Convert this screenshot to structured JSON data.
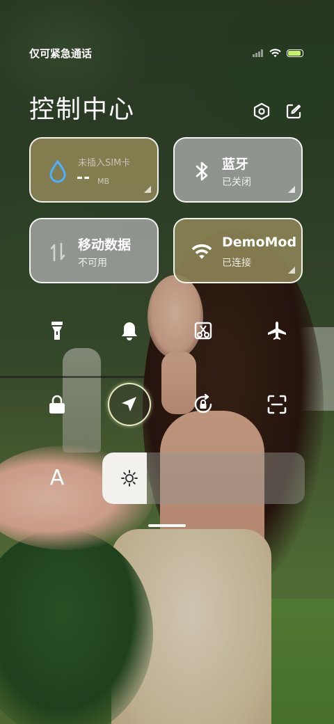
{
  "status_bar": {
    "carrier_text": "仅可紧急通话",
    "battery_level": 0.9
  },
  "header": {
    "title": "控制中心",
    "settings_icon": "hexagon-settings-icon",
    "edit_icon": "edit-icon"
  },
  "tiles": {
    "mobile_data_usage": {
      "top_label": "未插入SIM卡",
      "value": "--",
      "unit": "MB",
      "icon": "water-drop-icon"
    },
    "bluetooth": {
      "title": "蓝牙",
      "subtitle": "已关闭",
      "icon": "bluetooth-icon"
    },
    "mobile_data": {
      "title": "移动数据",
      "subtitle": "不可用",
      "icon": "data-arrows-icon"
    },
    "wifi": {
      "title": "DemoMod",
      "subtitle": "已连接",
      "icon": "wifi-icon"
    }
  },
  "toggles_row1": [
    "flashlight-icon",
    "bell-icon",
    "screenshot-icon",
    "airplane-icon"
  ],
  "toggles_row2": [
    "lock-icon",
    "location-icon",
    "rotation-lock-icon",
    "scan-icon"
  ],
  "active_toggle": "location-icon",
  "brightness": {
    "font_label": "A",
    "level": 0.22
  },
  "colors": {
    "tile_active": "#8a8254",
    "tile_inactive": "#9ea09e",
    "location_ring": "#f0f5c8",
    "battery": "#c8f06a"
  }
}
